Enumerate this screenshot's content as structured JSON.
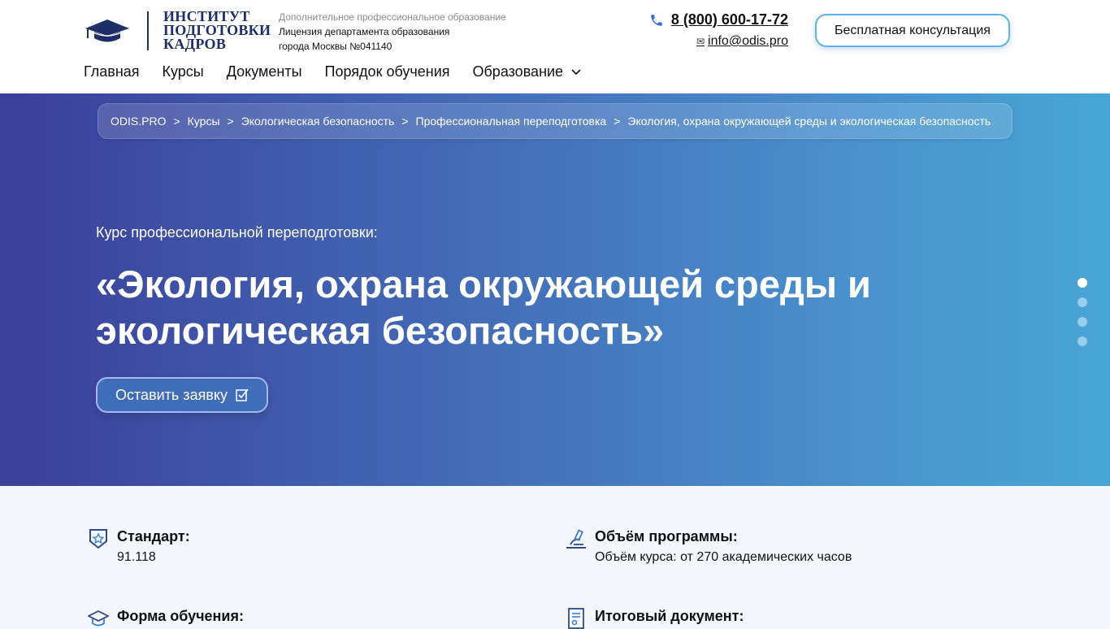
{
  "header": {
    "logo_lines": [
      "ИНСТИТУТ",
      "ПОДГОТОВКИ",
      "КАДРОВ"
    ],
    "license_line1": "Дополнительное профессиональное образование",
    "license_line2": "Лицензия департамента образования",
    "license_line3": "города Москвы №041140",
    "phone": "8 (800) 600-17-72",
    "email": "info@odis.pro",
    "consult_label": "Бесплатная консультация"
  },
  "nav": {
    "items": [
      "Главная",
      "Курсы",
      "Документы",
      "Порядок обучения",
      "Образование"
    ]
  },
  "breadcrumb": [
    "ODIS.PRO",
    "Курсы",
    "Экологическая безопасность",
    "Профессиональная переподготовка",
    "Экология, охрана окружающей среды и экологическая безопасность"
  ],
  "breadcrumb_sep": ">",
  "hero": {
    "subtitle": "Курс профессиональной переподготовки:",
    "title": "«Экология, охрана окружающей среды и экологическая безопасность»",
    "apply_label": "Оставить заявку",
    "slides_total": 4,
    "active_slide": 1
  },
  "features": {
    "standard_title": "Стандарт:",
    "standard_value": "91.118",
    "volume_title": "Объём программы:",
    "volume_value": "Объём курса: от 270 академических часов",
    "form_title": "Форма обучения:",
    "doc_title": "Итоговый документ:"
  },
  "colors": {
    "brand_dark": "#1d2f66",
    "hero_start": "#3b3f9a",
    "hero_end": "#47a6d4"
  }
}
